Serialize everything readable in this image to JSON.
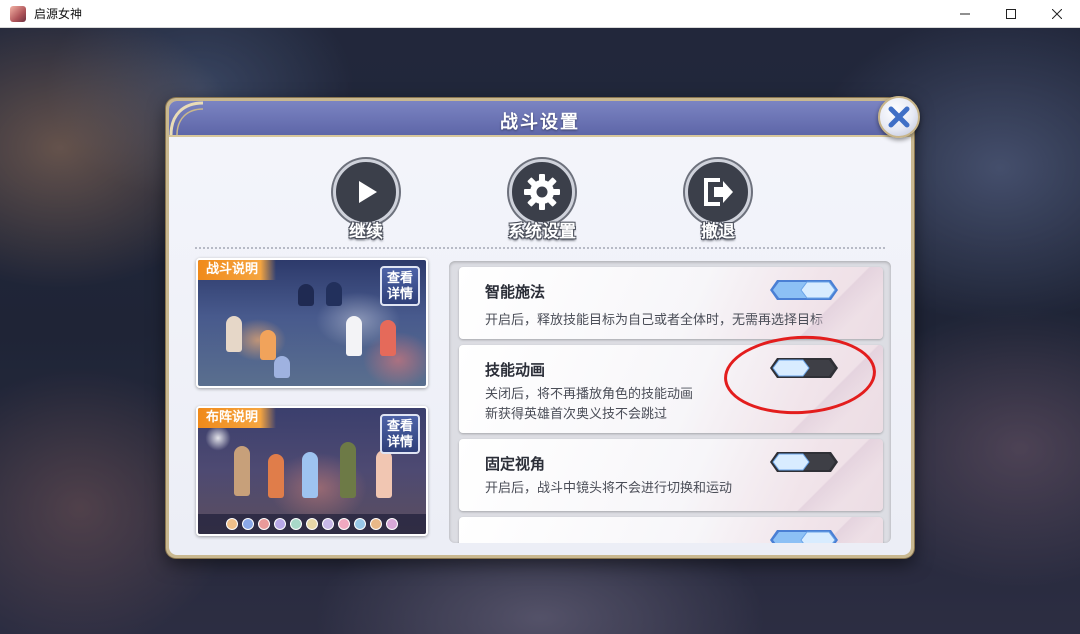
{
  "window": {
    "title": "启源女神",
    "icon": "app-portrait-icon"
  },
  "window_controls": {
    "minimize": "minimize-icon",
    "maximize": "maximize-icon",
    "close": "close-icon"
  },
  "dialog": {
    "title": "战斗设置",
    "close_icon": "close-x-icon",
    "actions": [
      {
        "label": "继续",
        "icon": "play-icon"
      },
      {
        "label": "系统设置",
        "icon": "gear-icon"
      },
      {
        "label": "撤退",
        "icon": "exit-icon"
      }
    ],
    "guides": [
      {
        "tag": "战斗说明",
        "detail": "查看详情"
      },
      {
        "tag": "布阵说明",
        "detail": "查看详情"
      }
    ],
    "settings": [
      {
        "title": "智能施法",
        "desc_lines": [
          "开启后，释放技能目标为自己或者全体时，无需再选择目标"
        ],
        "enabled": true
      },
      {
        "title": "技能动画",
        "desc_lines": [
          "关闭后，将不再播放角色的技能动画",
          "新获得英雄首次奥义技不会跳过"
        ],
        "enabled": false
      },
      {
        "title": "固定视角",
        "desc_lines": [
          "开启后，战斗中镜头将不会进行切换和运动"
        ],
        "enabled": false
      },
      {
        "title": "",
        "desc_lines": [],
        "enabled": true
      }
    ]
  },
  "colors": {
    "header": "#6a72b4",
    "accent_orange": "#f08a1a",
    "toggle_on": "#7fb4f2",
    "annotation_red": "#e31d1d"
  }
}
